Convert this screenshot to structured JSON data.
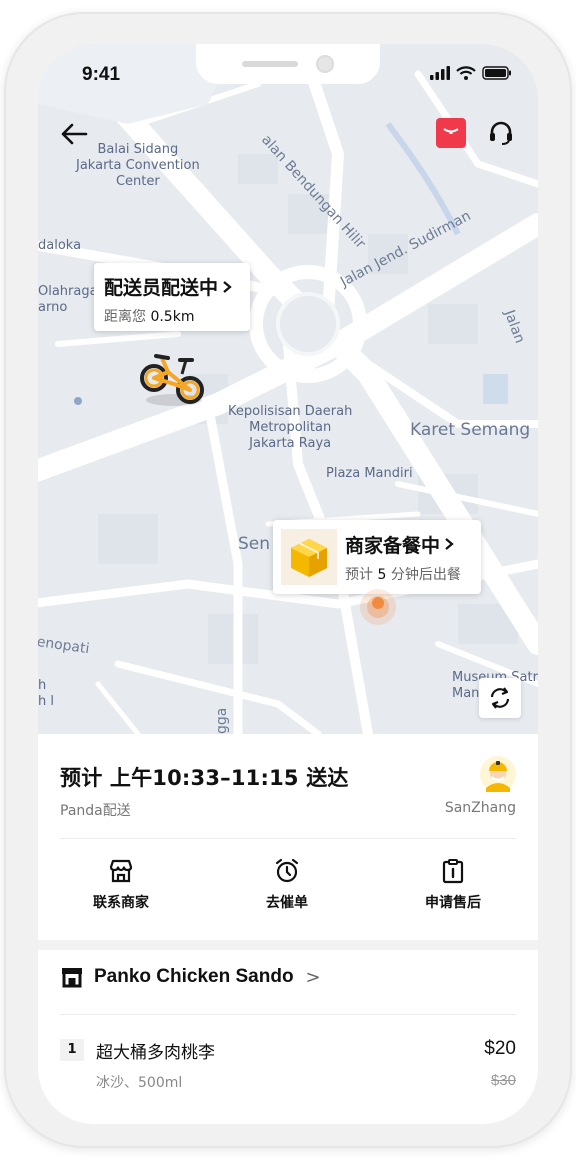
{
  "status_bar": {
    "time": "9:41"
  },
  "map": {
    "labels": {
      "convention": "Balai Sidang\nJakarta Convention\nCenter",
      "bendungan": "alan Bendungan Hilir",
      "sudirman": "Jalan Jend. Sudirman",
      "daloka": "daloka",
      "olahraga": "Olahraga\narno",
      "jalan_right": "Jalan",
      "police": "Kepolisisan Daerah\nMetropolitan\nJakarta Raya",
      "karet": "Karet Semang",
      "plaza": "Plaza Mandiri",
      "sen": "Sen",
      "enopati": "enopati",
      "h": "h\nh l",
      "museum": "Museum Satr\nMandala",
      "gga": "gga"
    }
  },
  "rider_bubble": {
    "title": "配送员配送中",
    "distance_prefix": "距离您",
    "distance": "0.5km"
  },
  "shop_bubble": {
    "title": "商家备餐中",
    "prep_prefix": "预计",
    "prep_minutes": "5",
    "prep_suffix": "分钟后出餐"
  },
  "delivery": {
    "eta": "预计 上午10:33–11:15 送达",
    "courier_service": "Panda配送",
    "rider_name": "SanZhang"
  },
  "actions": [
    {
      "label": "联系商家",
      "icon": "store-icon"
    },
    {
      "label": "去催单",
      "icon": "alarm-clock-icon"
    },
    {
      "label": "申请售后",
      "icon": "clipboard-icon"
    }
  ],
  "store": {
    "name": "Panko Chicken Sando",
    "chevron": ">"
  },
  "items": [
    {
      "qty": "1",
      "name": "超大桶多肉桃李",
      "price": "$20",
      "spec": "冰沙、500ml",
      "original_price": "$30"
    }
  ],
  "colors": {
    "accent_red": "#f0394a",
    "rider_orange": "#f5a623",
    "shop_yellow": "#f5b800",
    "pin_orange": "#f08a3e"
  }
}
